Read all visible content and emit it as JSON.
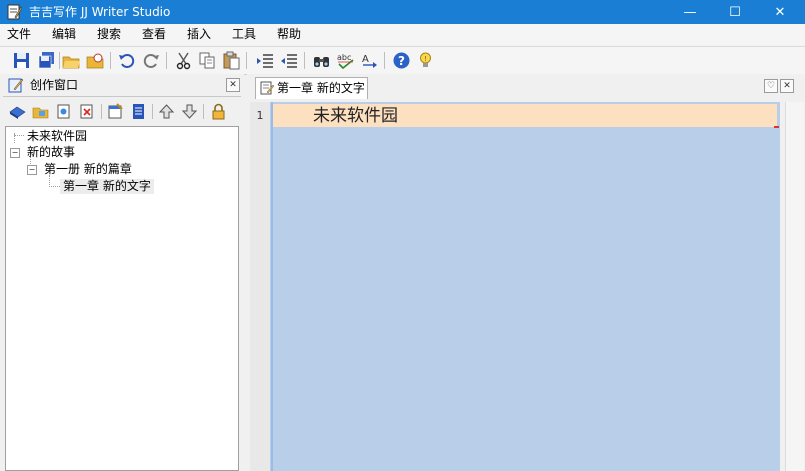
{
  "window": {
    "title": "吉吉写作 JJ Writer Studio",
    "minimize": "—",
    "maximize": "☐",
    "close": "✕"
  },
  "menu": [
    "文件",
    "编辑",
    "搜索",
    "查看",
    "插入",
    "工具",
    "帮助"
  ],
  "left_panel": {
    "title": "创作窗口",
    "close": "✕"
  },
  "tree": {
    "item1": "未来软件园",
    "item2": "新的故事",
    "item3": "第一册 新的篇章",
    "item4": "第一章 新的文字",
    "expander": "−"
  },
  "editor": {
    "tab_label": "第一章 新的文字",
    "line_number": "1",
    "line_text": "未来软件园",
    "btn_list": "♡",
    "btn_close": "✕"
  },
  "colors": {
    "titlebar": "#1a7fd4",
    "editor_bg": "#b9cfe9",
    "current_line": "#fde0c0"
  }
}
